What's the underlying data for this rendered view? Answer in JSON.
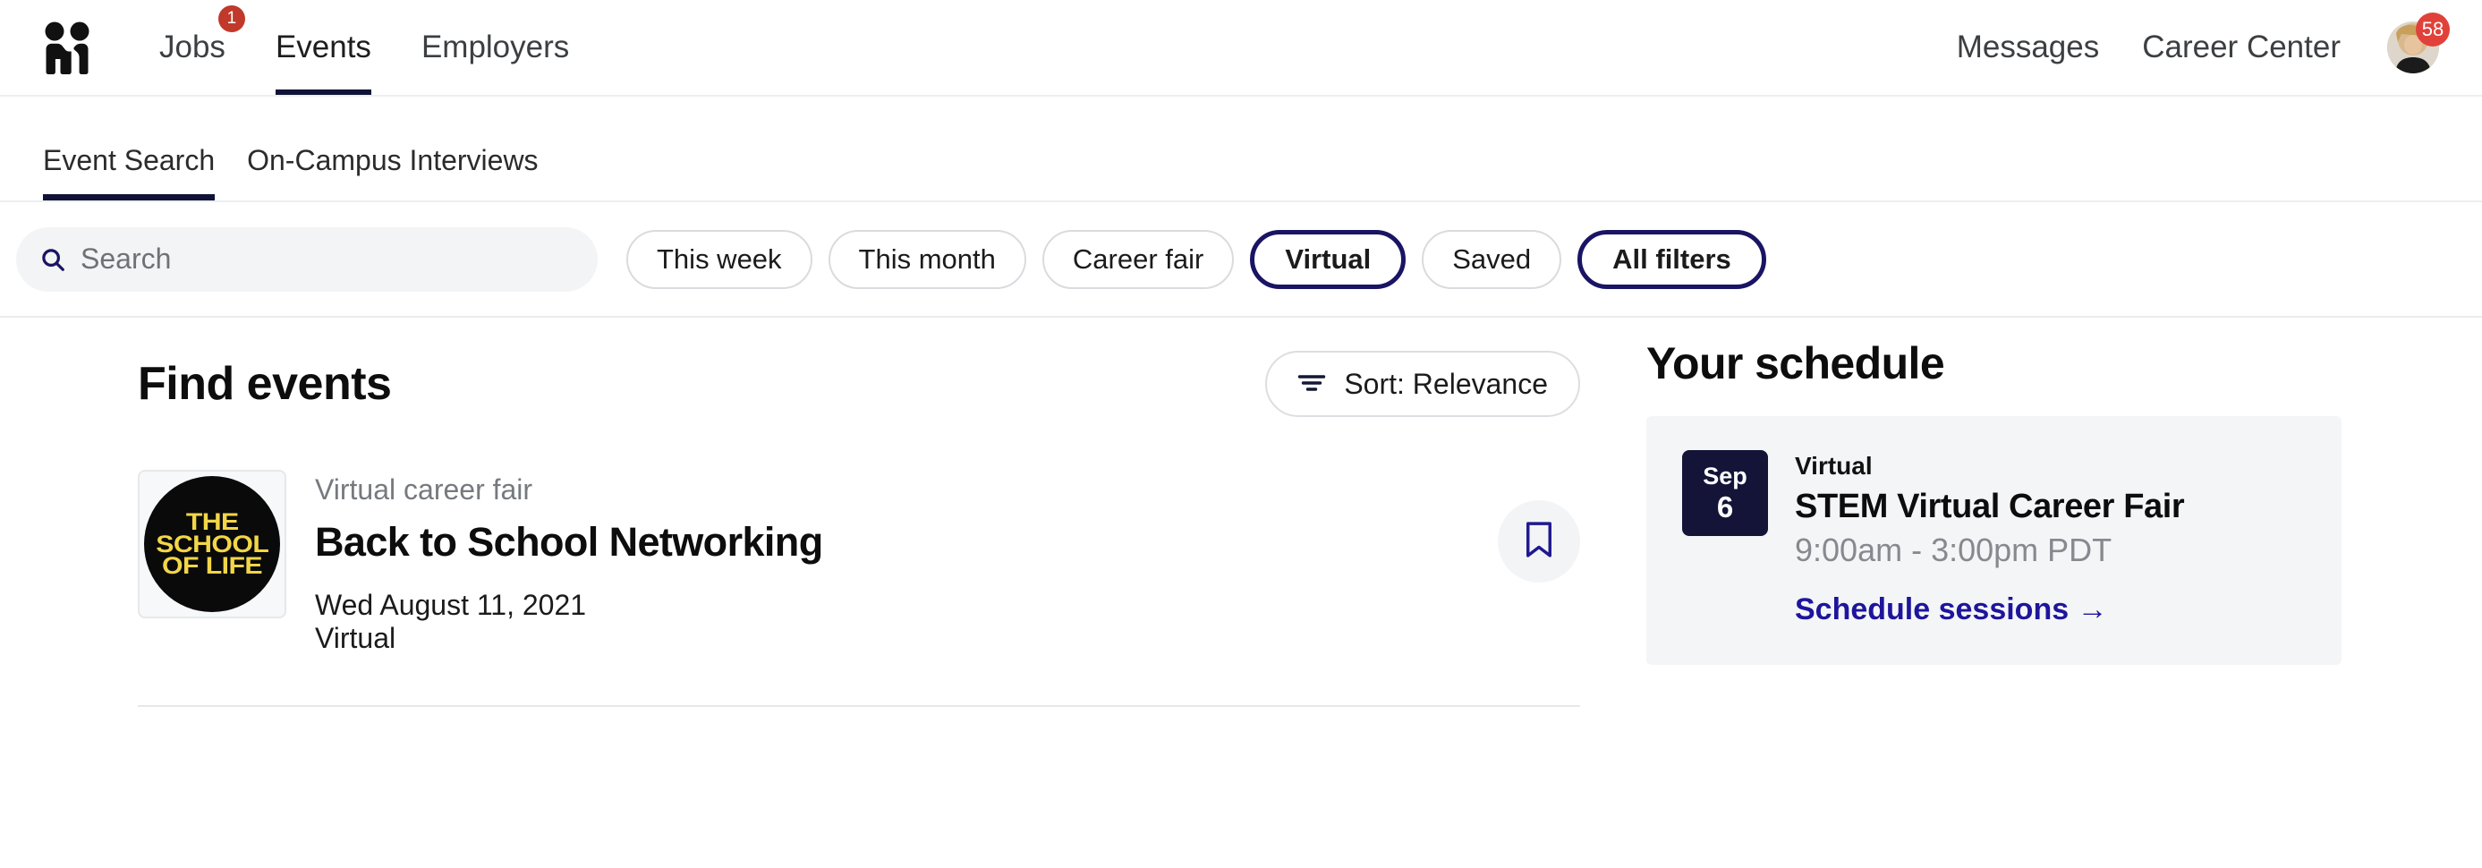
{
  "brand": {
    "logo_icon": "handshake-logo-icon",
    "accent_navy": "#101336",
    "accent_blue": "#1e159c",
    "badge_red": "#c0392b"
  },
  "topnav": {
    "left_items": [
      {
        "label": "Jobs",
        "active": false,
        "badge": "1"
      },
      {
        "label": "Events",
        "active": true,
        "badge": ""
      },
      {
        "label": "Employers",
        "active": false,
        "badge": ""
      }
    ],
    "right_items": [
      {
        "label": "Messages"
      },
      {
        "label": "Career Center"
      }
    ],
    "avatar_badge": "58"
  },
  "subtabs": [
    {
      "label": "Event Search",
      "active": true
    },
    {
      "label": "On-Campus Interviews",
      "active": false
    }
  ],
  "filterbar": {
    "search": {
      "value": "",
      "placeholder": "Search",
      "icon": "search-icon"
    },
    "chips": [
      {
        "label": "This week",
        "selected": false
      },
      {
        "label": "This month",
        "selected": false
      },
      {
        "label": "Career fair",
        "selected": false
      },
      {
        "label": "Virtual",
        "selected": true
      },
      {
        "label": "Saved",
        "selected": false
      },
      {
        "label": "All filters",
        "selected": true
      }
    ]
  },
  "main": {
    "title": "Find events",
    "sort": {
      "label": "Sort: Relevance",
      "icon": "sort-icon"
    },
    "events": [
      {
        "kicker": "Virtual career fair",
        "title": "Back to School Networking",
        "date": "Wed August 11, 2021",
        "location": "Virtual",
        "bookmark_icon": "bookmark-icon",
        "logo": {
          "line1": "THE",
          "line2": "SCHOOL",
          "line3": "OF LIFE",
          "text_color": "#f2d648",
          "bg_color": "#0a0a0a"
        }
      }
    ]
  },
  "schedule": {
    "title": "Your schedule",
    "items": [
      {
        "month": "Sep",
        "day": "6",
        "kicker": "Virtual",
        "name": "STEM Virtual Career Fair",
        "time": "9:00am - 3:00pm PDT",
        "link": "Schedule sessions →"
      }
    ]
  }
}
